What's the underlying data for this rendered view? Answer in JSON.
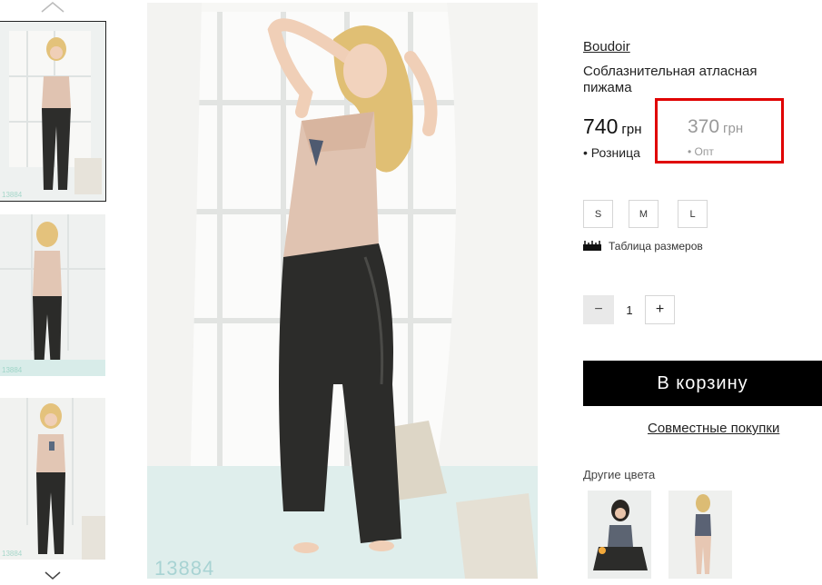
{
  "thumbnails": {
    "codes": [
      "13884",
      "13884",
      "13884"
    ]
  },
  "main_image": {
    "code": "13884"
  },
  "product": {
    "brand": "Boudoir",
    "title": "Соблазнительная атласная пижама",
    "retail_price": "740",
    "retail_currency": "грн",
    "retail_label": "• Розница",
    "opt_price": "370",
    "opt_currency": "грн",
    "opt_label": "• Опт"
  },
  "sizes": [
    "S",
    "M",
    "L"
  ],
  "size_table_label": "Таблица размеров",
  "quantity": {
    "minus": "−",
    "value": "1",
    "plus": "+"
  },
  "cart_button": "В корзину",
  "joint_purchase_link": "Совместные покупки",
  "other_colors": {
    "label": "Другие цвета"
  },
  "colors": {
    "highlight": "#e00000",
    "cart_bg": "#000000",
    "opt_text": "#999999"
  },
  "icons": [
    "chevron-up-icon",
    "chevron-down-icon",
    "ruler-icon"
  ]
}
